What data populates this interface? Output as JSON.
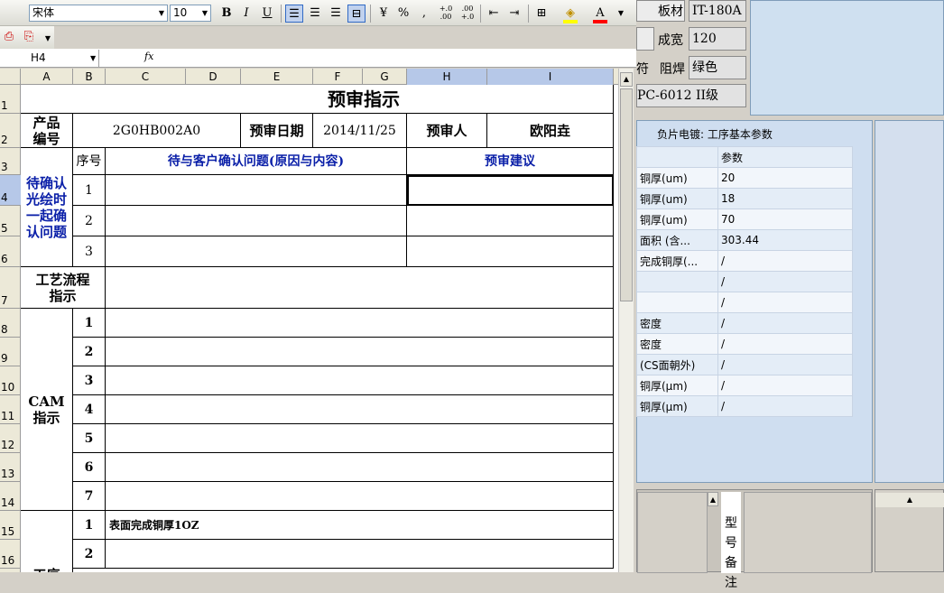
{
  "toolbar": {
    "font_name": "宋体",
    "font_size": "10",
    "bold": "B",
    "italic": "I",
    "underline": "U",
    "percent": "%",
    "comma": ",",
    "inc_decimal": "+.0 .00",
    "dec_decimal": ".00 +.0"
  },
  "formula_bar": {
    "name_box": "H4",
    "fx": "fx",
    "formula": ""
  },
  "columns": [
    "A",
    "B",
    "C",
    "D",
    "E",
    "F",
    "G",
    "H",
    "I"
  ],
  "rows": [
    "1",
    "2",
    "3",
    "4",
    "5",
    "6",
    "7",
    "8",
    "9",
    "10",
    "11",
    "12",
    "13",
    "14",
    "15",
    "16"
  ],
  "sheet": {
    "title": "预审指示",
    "product_label": "产品\n编号",
    "product_no": "2G0HB002A0",
    "review_date_label": "预审日期",
    "review_date": "2014/11/25",
    "reviewer_label": "预审人",
    "reviewer": "欧阳垚",
    "seq_label": "序号",
    "customer_issue_header": "待与客户确认问题(原因与内容)",
    "suggestion_header": "预审建议",
    "pending_label": "待确认\n光绘时\n一起确\n认问题",
    "pending_seq": [
      "1",
      "2",
      "3"
    ],
    "process_label": "工艺流程\n指示",
    "cam_label": "CAM\n指示",
    "cam_seq": [
      "1",
      "2",
      "3",
      "4",
      "5",
      "6",
      "7"
    ],
    "craft_seq": [
      "1",
      "2"
    ],
    "craft_row1_text": "表面完成铜厚1OZ",
    "craft_label_partial": "工序"
  },
  "right_panel": {
    "board_label": "板材",
    "board_value": "IT-180A",
    "width_label": "成宽",
    "width_value": "120",
    "mark_label": "符",
    "solder_label": "阻焊",
    "solder_value": "绿色",
    "standard_value": "PC-6012 II级",
    "plating_title": "负片电镀: 工序基本参数",
    "param_header": "参数",
    "params": [
      {
        "name": "铜厚(um)",
        "value": "20"
      },
      {
        "name": "铜厚(um)",
        "value": "18"
      },
      {
        "name": "铜厚(um)",
        "value": "70"
      },
      {
        "name": "面积 (含...",
        "value": "303.44"
      },
      {
        "name": "完成铜厚(...",
        "value": "/"
      },
      {
        "name": "",
        "value": "/"
      },
      {
        "name": "",
        "value": "/"
      },
      {
        "name": "密度",
        "value": "/"
      },
      {
        "name": "密度",
        "value": "/"
      },
      {
        "name": "(CS面朝外)",
        "value": "/"
      },
      {
        "name": "铜厚(μm)",
        "value": "/"
      },
      {
        "name": "铜厚(μm)",
        "value": "/"
      }
    ],
    "type_note": "型\n号\n备\n注"
  }
}
